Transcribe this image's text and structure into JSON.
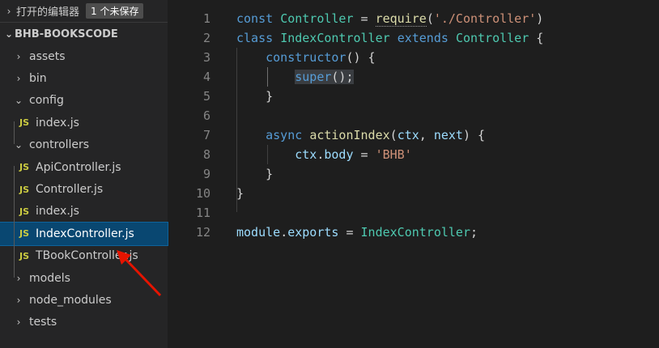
{
  "sidebar": {
    "open_editors_title": "打开的编辑器",
    "unsaved_badge": "1 个未保存",
    "project_title": "BHB-BOOKSCODE",
    "tree": [
      {
        "kind": "folder",
        "label": "assets",
        "expanded": false,
        "depth": 0
      },
      {
        "kind": "folder",
        "label": "bin",
        "expanded": false,
        "depth": 0
      },
      {
        "kind": "folder",
        "label": "config",
        "expanded": true,
        "depth": 0
      },
      {
        "kind": "file",
        "label": "index.js",
        "depth": 1
      },
      {
        "kind": "folder",
        "label": "controllers",
        "expanded": true,
        "depth": 0
      },
      {
        "kind": "file",
        "label": "ApiController.js",
        "depth": 1
      },
      {
        "kind": "file",
        "label": "Controller.js",
        "depth": 1
      },
      {
        "kind": "file",
        "label": "index.js",
        "depth": 1
      },
      {
        "kind": "file",
        "label": "IndexController.js",
        "depth": 1,
        "selected": true
      },
      {
        "kind": "file",
        "label": "TBookController.js",
        "depth": 1
      },
      {
        "kind": "folder",
        "label": "models",
        "expanded": false,
        "depth": 0
      },
      {
        "kind": "folder",
        "label": "node_modules",
        "expanded": false,
        "depth": 0
      },
      {
        "kind": "folder",
        "label": "tests",
        "expanded": false,
        "depth": 0
      }
    ],
    "js_icon_text": "JS"
  },
  "editor": {
    "lines": [
      {
        "n": "1",
        "tokens": [
          [
            "kw",
            "const "
          ],
          [
            "cls",
            "Controller"
          ],
          [
            "plain",
            " = "
          ],
          [
            "fnu",
            "require"
          ],
          [
            "plain",
            "("
          ],
          [
            "str",
            "'./Controller'"
          ],
          [
            "plain",
            ")"
          ]
        ]
      },
      {
        "n": "2",
        "tokens": [
          [
            "kw",
            "class "
          ],
          [
            "cls",
            "IndexController "
          ],
          [
            "kw",
            "extends "
          ],
          [
            "cls",
            "Controller"
          ],
          [
            "plain",
            " {"
          ]
        ]
      },
      {
        "n": "3",
        "tokens": [
          [
            "plain",
            "    "
          ],
          [
            "kw",
            "constructor"
          ],
          [
            "plain",
            "() {"
          ]
        ]
      },
      {
        "n": "4",
        "tokens": [
          [
            "plain",
            "        "
          ],
          [
            "kwhl",
            "super"
          ],
          [
            "plainhl",
            "();"
          ]
        ]
      },
      {
        "n": "5",
        "tokens": [
          [
            "plain",
            "    }"
          ]
        ]
      },
      {
        "n": "6",
        "tokens": []
      },
      {
        "n": "7",
        "tokens": [
          [
            "plain",
            "    "
          ],
          [
            "kw",
            "async "
          ],
          [
            "fn",
            "actionIndex"
          ],
          [
            "plain",
            "("
          ],
          [
            "var",
            "ctx"
          ],
          [
            "plain",
            ", "
          ],
          [
            "var",
            "next"
          ],
          [
            "plain",
            ") {"
          ]
        ]
      },
      {
        "n": "8",
        "tokens": [
          [
            "plain",
            "        "
          ],
          [
            "var",
            "ctx"
          ],
          [
            "plain",
            "."
          ],
          [
            "var",
            "body"
          ],
          [
            "plain",
            " = "
          ],
          [
            "str",
            "'BHB'"
          ]
        ]
      },
      {
        "n": "9",
        "tokens": [
          [
            "plain",
            "    }"
          ]
        ]
      },
      {
        "n": "10",
        "tokens": [
          [
            "plain",
            "}"
          ]
        ]
      },
      {
        "n": "11",
        "tokens": []
      },
      {
        "n": "12",
        "tokens": [
          [
            "var",
            "module"
          ],
          [
            "plain",
            "."
          ],
          [
            "var",
            "exports"
          ],
          [
            "plain",
            " = "
          ],
          [
            "cls",
            "IndexController"
          ],
          [
            "plain",
            ";"
          ]
        ]
      }
    ]
  },
  "colors": {
    "keyword": "#569cd6",
    "class": "#4ec9b0",
    "function": "#dcdcaa",
    "variable": "#9cdcfe",
    "string": "#ce9178",
    "selection": "#094771",
    "arrow": "#e51400"
  },
  "icons": [
    "chevron-down-icon",
    "chevron-right-icon",
    "js-file-icon",
    "red-arrow-annotation"
  ]
}
